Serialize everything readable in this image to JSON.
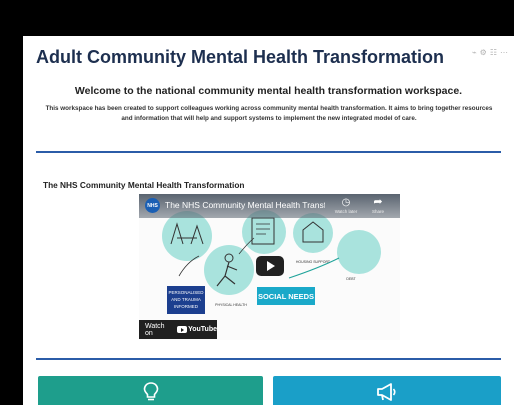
{
  "page": {
    "title": "Adult Community Mental Health Transformation",
    "toolbar_icons": [
      "rss-icon",
      "settings-icon",
      "grid-icon",
      "more-icon"
    ],
    "welcome_heading": "Welcome to the national community mental health transformation workspace.",
    "intro_text": "This workspace has been created to support colleagues working across community mental health transformation. It aims to bring together resources and information that will help and support systems to implement the new integrated model of care.",
    "section_heading": "The NHS Community Mental Health Transformation"
  },
  "video": {
    "channel_badge": "NHS",
    "title": "The NHS Community Mental Health Transfo...",
    "watch_later_label": "Watch later",
    "share_label": "Share",
    "watch_on_label": "Watch on",
    "youtube_label": "YouTube",
    "art_labels": {
      "personalised": [
        "PERSONALISED",
        "AND TRAUMA",
        "INFORMED"
      ],
      "physical_health": "PHYSICAL HEALTH",
      "social_needs": "SOCIAL NEEDS",
      "housing": "HOUSING SUPPORT",
      "debt": "DEBT"
    }
  },
  "cards": [
    {
      "icon": "lightbulb-icon"
    },
    {
      "icon": "megaphone-icon"
    }
  ],
  "colors": {
    "title": "#1d2f4f",
    "divider": "#2b5ca8",
    "card_green": "#1e9e8c",
    "card_blue": "#1a9fc8",
    "illustration_teal": "#a9e3dd"
  }
}
